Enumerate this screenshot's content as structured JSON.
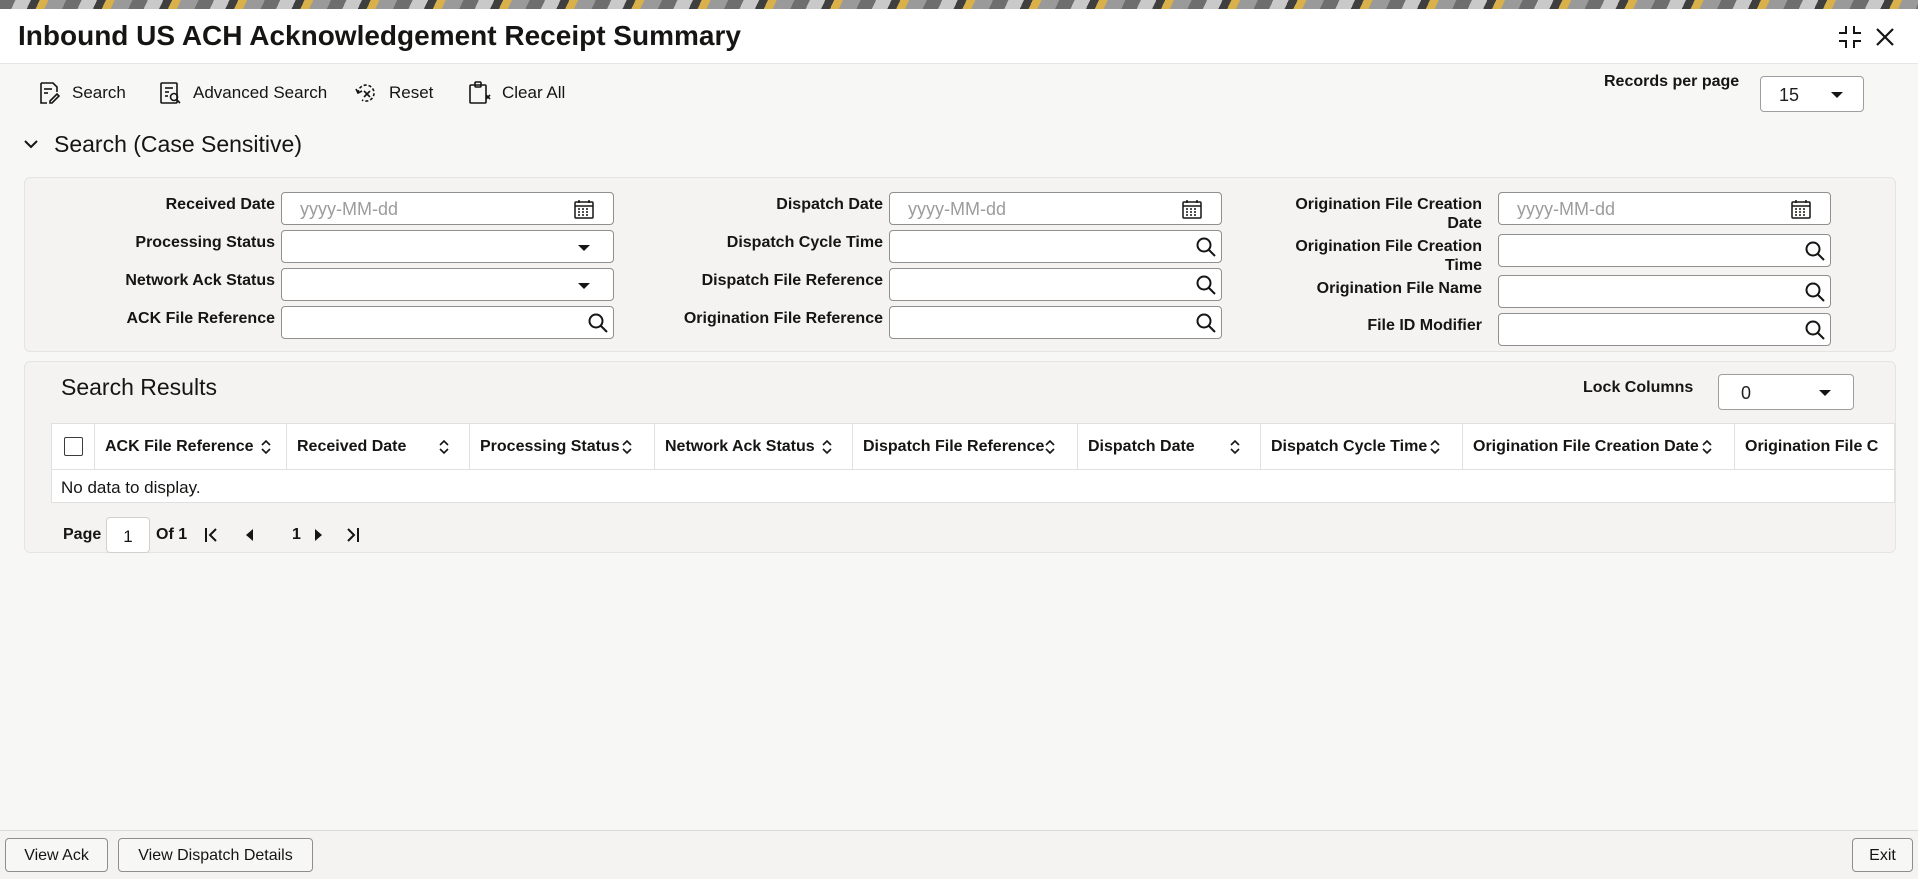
{
  "window": {
    "title": "Inbound US ACH Acknowledgement Receipt Summary"
  },
  "toolbar": {
    "search_label": "Search",
    "advanced_search_label": "Advanced Search",
    "reset_label": "Reset",
    "clear_all_label": "Clear All",
    "records_per_page_label": "Records per page",
    "records_per_page_value": "15"
  },
  "search_section": {
    "title": "Search (Case Sensitive)",
    "fields": {
      "received_date": {
        "label": "Received Date",
        "placeholder": "yyyy-MM-dd"
      },
      "processing_status": {
        "label": "Processing Status",
        "value": ""
      },
      "network_ack_status": {
        "label": "Network Ack Status",
        "value": ""
      },
      "ack_file_reference": {
        "label": "ACK File Reference",
        "value": ""
      },
      "dispatch_date": {
        "label": "Dispatch Date",
        "placeholder": "yyyy-MM-dd"
      },
      "dispatch_cycle_time": {
        "label": "Dispatch Cycle Time",
        "value": ""
      },
      "dispatch_file_reference": {
        "label": "Dispatch File Reference",
        "value": ""
      },
      "origination_file_reference": {
        "label": "Origination File Reference",
        "value": ""
      },
      "origination_file_creation_date": {
        "label_line1": "Origination File Creation",
        "label_line2": "Date",
        "placeholder": "yyyy-MM-dd"
      },
      "origination_file_creation_time": {
        "label_line1": "Origination File Creation",
        "label_line2": "Time",
        "value": ""
      },
      "origination_file_name": {
        "label": "Origination File Name",
        "value": ""
      },
      "file_id_modifier": {
        "label": "File ID Modifier",
        "value": ""
      }
    }
  },
  "results": {
    "title": "Search Results",
    "lock_columns_label": "Lock Columns",
    "lock_columns_value": "0",
    "columns": [
      "ACK File Reference",
      "Received Date",
      "Processing Status",
      "Network Ack Status",
      "Dispatch File Reference",
      "Dispatch Date",
      "Dispatch Cycle Time",
      "Origination File Creation Date",
      "Origination File C"
    ],
    "empty_message": "No data to display."
  },
  "pagination": {
    "page_label": "Page",
    "current_page": "1",
    "of_label": "Of 1",
    "nav_page": "1"
  },
  "footer": {
    "view_ack_label": "View Ack",
    "view_dispatch_details_label": "View Dispatch Details",
    "exit_label": "Exit"
  },
  "icons": {
    "calendar": "calendar-icon",
    "search": "search-icon",
    "dropdown": "chevron-down-icon",
    "sort": "sort-icon",
    "collapse": "collapse-icon",
    "close": "close-icon"
  },
  "colors": {
    "background": "#f7f7f6",
    "panel": "#f4f3f1",
    "text": "#161513",
    "placeholder": "#9c9c9c"
  }
}
